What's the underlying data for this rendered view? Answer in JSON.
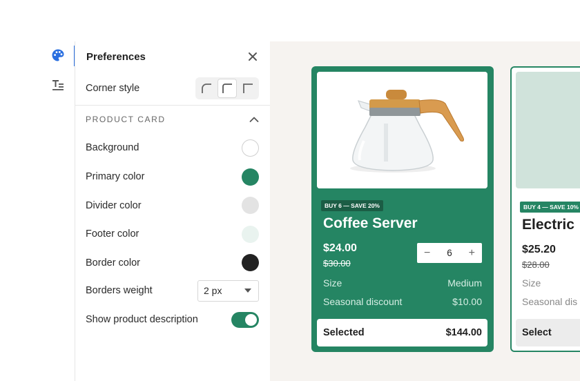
{
  "rail": {
    "items": [
      {
        "icon": "palette-icon",
        "active": true
      },
      {
        "icon": "text-format-icon",
        "active": false
      }
    ]
  },
  "panel": {
    "title": "Preferences",
    "corner_style": {
      "label": "Corner style",
      "options": [
        "rounded",
        "medium",
        "square"
      ],
      "selected": "medium"
    },
    "section": {
      "title": "PRODUCT CARD",
      "expanded": true
    },
    "colors": [
      {
        "label": "Background",
        "color": "#ffffff"
      },
      {
        "label": "Primary color",
        "color": "#258563"
      },
      {
        "label": "Divider color",
        "color": "#e3e3e3"
      },
      {
        "label": "Footer color",
        "color": "#e9f3ef"
      },
      {
        "label": "Border color",
        "color": "#222222"
      }
    ],
    "borders_weight": {
      "label": "Borders weight",
      "value": "2 px"
    },
    "show_description": {
      "label": "Show product description",
      "on": true
    }
  },
  "cards": [
    {
      "badge": "BUY 6 — SAVE 20%",
      "title": "Coffee Server",
      "price": "$24.00",
      "old_price": "$30.00",
      "quantity": "6",
      "size_label": "Size",
      "size_value": "Medium",
      "discount_label": "Seasonal discount",
      "discount_value": "$10.00",
      "footer_label": "Selected",
      "footer_total": "$144.00"
    },
    {
      "badge": "BUY 4 — SAVE 10%",
      "title": "Electric",
      "price": "$25.20",
      "old_price": "$28.00",
      "size_label": "Size",
      "discount_label": "Seasonal dis",
      "footer_label": "Select"
    }
  ],
  "colors": {
    "primary": "#258563",
    "accent": "#2a6fe0",
    "canvas_bg": "#f6f3f0"
  }
}
